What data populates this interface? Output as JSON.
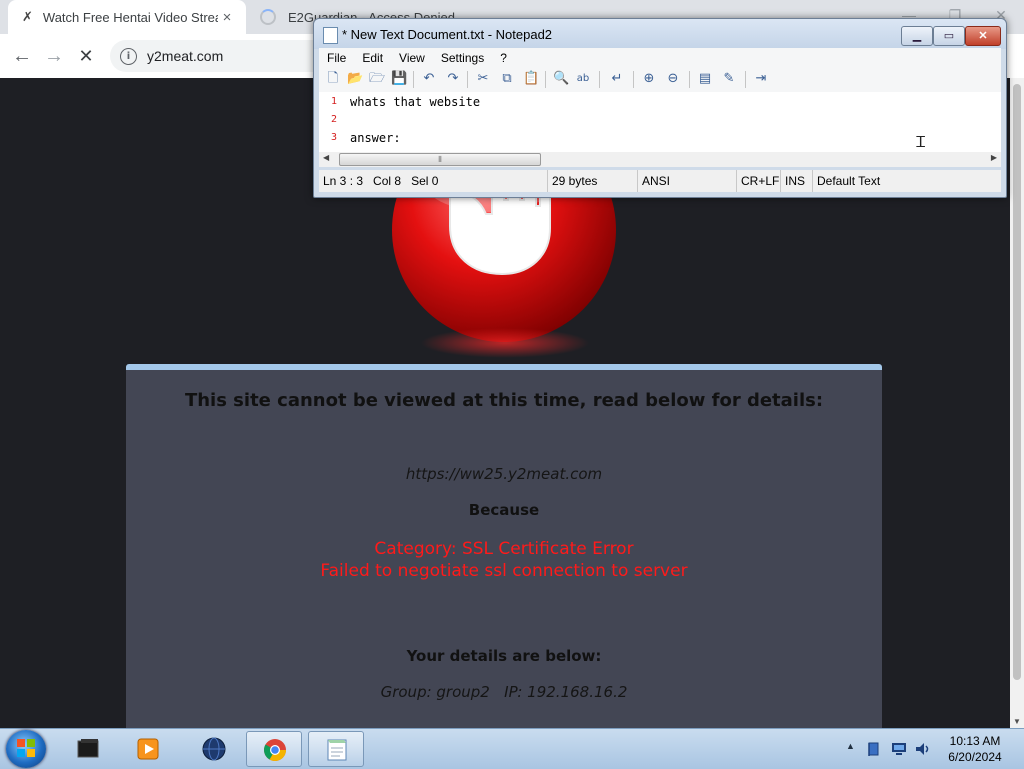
{
  "browser": {
    "tabs": [
      {
        "title": "Watch Free Hentai Video Stream",
        "icon": "page-favicon-icon",
        "close": "×"
      },
      {
        "title": "E2Guardian - Access Denied",
        "icon": "loading-spinner-icon"
      }
    ],
    "window_controls": [
      "—",
      "❐",
      "✕"
    ],
    "nav": {
      "back": "←",
      "forward": "→",
      "stop": "✕"
    },
    "address": {
      "url": "y2meat.com",
      "info_glyph": "i"
    }
  },
  "block_page": {
    "heading": "This site cannot be viewed at this time, read below for details:",
    "blocked_url": "https://ww25.y2meat.com",
    "because_label": "Because",
    "category": "Category: SSL Certificate Error",
    "reason": "Failed to negotiate ssl connection to server",
    "details_title": "Your details are below:",
    "group_ip": "Group: group2   IP: 192.168.16.2",
    "accent_color": "#a4c8ea",
    "error_color": "#ff1a1a"
  },
  "notepad": {
    "title": "* New Text Document.txt - Notepad2",
    "caption_buttons": {
      "minimize": "▁",
      "maximize": "▭",
      "close": "✕"
    },
    "menu": [
      "File",
      "Edit",
      "View",
      "Settings",
      "?"
    ],
    "toolbar_icons": [
      {
        "name": "new-icon",
        "glyph": "🗋"
      },
      {
        "name": "open-icon",
        "glyph": "📂"
      },
      {
        "name": "browse-icon",
        "glyph": "🗁"
      },
      {
        "name": "save-icon",
        "glyph": "💾"
      },
      {
        "name": "undo-icon",
        "glyph": "↶"
      },
      {
        "name": "redo-icon",
        "glyph": "↷"
      },
      {
        "name": "cut-icon",
        "glyph": "✂"
      },
      {
        "name": "copy-icon",
        "glyph": "⧉"
      },
      {
        "name": "paste-icon",
        "glyph": "📋"
      },
      {
        "name": "find-icon",
        "glyph": "🔍"
      },
      {
        "name": "replace-icon",
        "glyph": "ab"
      },
      {
        "name": "wrap-icon",
        "glyph": "↵"
      },
      {
        "name": "zoom-in-icon",
        "glyph": "⊕"
      },
      {
        "name": "zoom-out-icon",
        "glyph": "⊖"
      },
      {
        "name": "scheme-icon",
        "glyph": "▤"
      },
      {
        "name": "customize-icon",
        "glyph": "✎"
      },
      {
        "name": "exit-icon",
        "glyph": "⇥"
      }
    ],
    "lines": [
      {
        "num": "1",
        "text": "whats that website"
      },
      {
        "num": "2",
        "text": ""
      },
      {
        "num": "3",
        "text": "answer:"
      }
    ],
    "status": {
      "position": "Ln 3 : 3",
      "column": "Col 8",
      "selection": "Sel 0",
      "size": "29 bytes",
      "encoding": "ANSI",
      "line_endings": "CR+LF",
      "mode": "INS",
      "scheme": "Default Text"
    }
  },
  "taskbar": {
    "apps": [
      {
        "name": "computer-app-icon"
      },
      {
        "name": "media-player-app-icon"
      },
      {
        "name": "globe-app-icon"
      },
      {
        "name": "chrome-app-icon",
        "active": true
      },
      {
        "name": "notepad2-app-icon",
        "active": true
      }
    ],
    "tray": {
      "show_hidden": "▲"
    },
    "clock": {
      "time": "10:13 AM",
      "date": "6/20/2024"
    }
  }
}
